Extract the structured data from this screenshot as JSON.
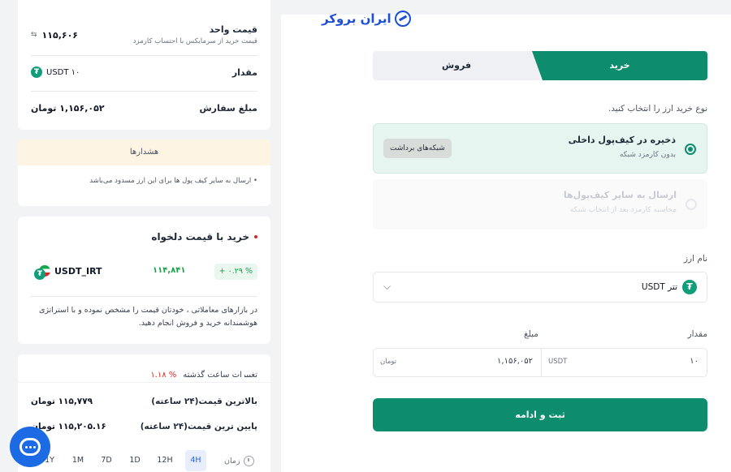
{
  "order_summary": {
    "unit_price_label": "قیمت واحد",
    "unit_price_desc": "قیمت خرید از سرمایکس با احتساب کارمزد",
    "unit_price_value": "۱۱۵,۶۰۶",
    "amount_label": "مقدار",
    "amount_value": "۱۰ USDT",
    "order_total_label": "مبلغ سفارش",
    "order_total_value": "۱,۱۵۶,۰۵۲ تومان"
  },
  "warnings": {
    "title": "هشدارها",
    "items": [
      "ارسال به سایر کیف پول ها برای این ارز مسدود می‌باشد"
    ]
  },
  "custom_price": {
    "title": "خرید با قیمت دلخواه",
    "pair": "USDT_IRT",
    "price": "۱۱۴,۸۴۱",
    "change": "+ ۰.۲۹ %",
    "description": "در بازارهای معاملاتی ، خودتان قیمت را مشخص نموده و با استراتژی هوشمندانه خرید و فروش انجام دهید."
  },
  "stats": {
    "partial_title": "تغییرات ساعت گذشته",
    "partial_value": "% ۱.۱۸",
    "high_label": "بالاترین قیمت(۲۴ ساعته)",
    "high_value": "۱۱۵,۷۷۹ تومان",
    "low_label": "پایین ترین قیمت(۲۴ ساعته)",
    "low_value": "۱۱۵,۲۰۵.۱۶ تومان",
    "timeframe_label": "زمان",
    "timeframes": [
      "4H",
      "12H",
      "1D",
      "7D",
      "1M",
      "1Y"
    ],
    "active_timeframe": "4H"
  },
  "brand": {
    "logo_text": "ایران بروکر"
  },
  "trade": {
    "tab_buy": "خرید",
    "tab_sell": "فروش",
    "purchase_type_prompt": "نوع خرید ارز را انتخاب کنید.",
    "option_internal_title": "ذخیره در کیف‌پول داخلی",
    "option_internal_desc": "بدون کارمزد شبکه",
    "network_button": "شبکه‌های برداشت",
    "option_external_title": "ارسال به سایر کیف‌پول‌ها",
    "option_external_desc": "محاسبه کارمزد بعد از انتخاب شبکه",
    "currency_label": "نام ارز",
    "currency_value": "تتر USDT",
    "quantity_label": "مقدار",
    "price_label": "مبلغ",
    "quantity_value": "۱۰",
    "quantity_unit": "USDT",
    "price_value": "۱,۱۵۶,۰۵۲",
    "price_unit": "تومان",
    "submit_label": "ثبت و ادامه"
  },
  "colors": {
    "primary": "#0e8c6e",
    "accent_blue": "#1d6ae5",
    "warning_bg": "#fdf4e3"
  }
}
